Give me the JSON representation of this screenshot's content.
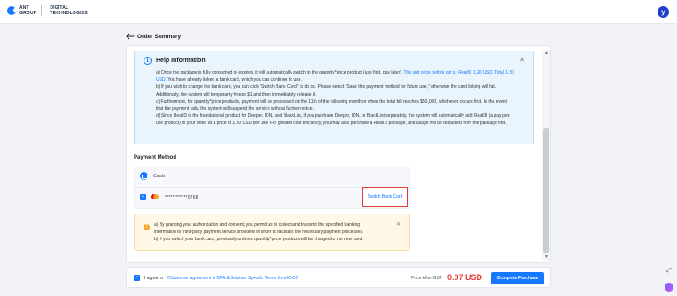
{
  "header": {
    "logo_line1": "ANT",
    "logo_line2": "GROUP",
    "logo_line3": "DIGITAL",
    "logo_line4": "TECHNOLOGIES",
    "avatar_letter": "y"
  },
  "page": {
    "back_icon": "arrow-left-icon",
    "title": "Order Summary"
  },
  "help": {
    "icon": "info-icon",
    "title": "Help Information",
    "close_icon": "close-icon",
    "close_glyph": "✕",
    "p_a_text": "a) Once the package is fully consumed or expires, it will automatically switch to the quantity*price product (use first, pay later).",
    "p_a_link1": "The unit price before gst is:",
    "p_a_link2": "RealID 1.20 USD,",
    "p_a_link3": "Total 1.20 USD.",
    "p_a_tail": "You have already linked a bank card, which you can continue to use.",
    "p_b": "b) If you wish to change the bank card, you can click \"Switch Bank Card\" to do so. Please select \"Save this payment method for future use,\" otherwise the card linking will fail. Additionally, the system will temporarily freeze $1 and then immediately release it.",
    "p_c": "c) Furthermore, for quantity*price products, payment will be processed on the 11th of the following month or when the total bill reaches $50,000, whichever occurs first. In the event that the payment fails, the system will suspend the service without further notice.",
    "p_d": "d) Since RealID is the foundational product for Deeper, IDN, and BlackList, if you purchase Deeper, IDN, or BlackList separately, the system will automatically add RealID (a pay-per-use product) to your order at a price of 1.20 USD per use. For greater cost efficiency, you may also purchase a RealID package, and usage will be deducted from the package first."
  },
  "payment": {
    "title": "Payment Method",
    "cards_icon": "credit-card-icon",
    "cards_label": "Cards",
    "check_glyph": "✓",
    "card_brand_icon": "mastercard-icon",
    "card_number": "************0768",
    "switch_label": "Switch Bank Card"
  },
  "warning": {
    "icon": "warning-icon",
    "icon_glyph": "!",
    "close_glyph": "✕",
    "a": "a) By granting your authorization and consent, you permit us to collect and transmit the specified banking information to third-party payment service providers in order to facilitate the necessary payment processes.",
    "b": "b) If you switch your bank card, previously ordered quantity*price products will be charged to the new card."
  },
  "footer": {
    "check_glyph": "✓",
    "agree_text": "I agree to",
    "agree_link": "《Customer Agreement & DPA & Solution Specific Terms for eKYC》",
    "price_label": "Price After GST:",
    "price": "0.07 USD",
    "buy_label": "Complete Purchase"
  },
  "scroll": {
    "up": "▲",
    "down": "▼"
  },
  "floating": {
    "expand_icon": "expand-icon",
    "expand_glyph": "⤢",
    "assistant_icon": "assistant-icon"
  },
  "colors": {
    "accent": "#1677ff",
    "danger": "#e53935",
    "help_bg": "#e9f4fd",
    "warn_bg": "#fff8e6"
  }
}
